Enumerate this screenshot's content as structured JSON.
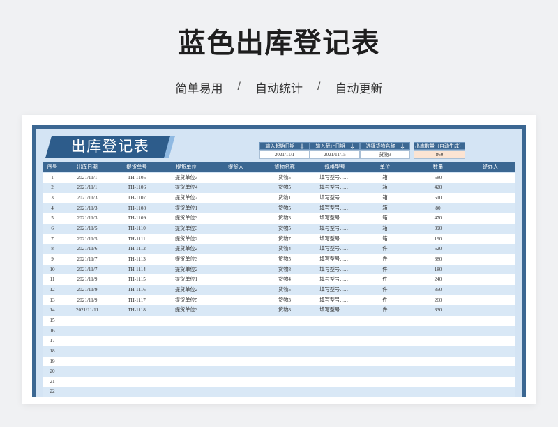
{
  "page": {
    "title": "蓝色出库登记表",
    "features": [
      "简单易用",
      "自动统计",
      "自动更新"
    ],
    "feature_separator": "/"
  },
  "sheet": {
    "banner_title": "出库登记表",
    "filters": [
      {
        "label": "输入起始日期",
        "icon": "down-arrow-icon",
        "value": "2021/11/1"
      },
      {
        "label": "输入截止日期",
        "icon": "down-arrow-icon",
        "value": "2021/11/15"
      },
      {
        "label": "选择货物名称",
        "icon": "down-arrow-icon",
        "value": "货物3"
      }
    ],
    "summary": {
      "label": "出库数量（自动生成）",
      "value": 860
    },
    "columns": [
      "序号",
      "出库日期",
      "提货单号",
      "提货单位",
      "提货人",
      "货物名称",
      "规格型号",
      "单位",
      "数量",
      "经办人"
    ],
    "rows": [
      [
        1,
        "2021/11/1",
        "TH-1105",
        "提货单位3",
        null,
        "货物5",
        "填写型号……",
        "箱",
        580,
        null
      ],
      [
        2,
        "2021/11/1",
        "TH-1106",
        "提货单位4",
        null,
        "货物5",
        "填写型号……",
        "箱",
        420,
        null
      ],
      [
        3,
        "2021/11/3",
        "TH-1107",
        "提货单位2",
        null,
        "货物1",
        "填写型号……",
        "箱",
        510,
        null
      ],
      [
        4,
        "2021/11/3",
        "TH-1108",
        "提货单位1",
        null,
        "货物5",
        "填写型号……",
        "箱",
        80,
        null
      ],
      [
        5,
        "2021/11/3",
        "TH-1109",
        "提货单位3",
        null,
        "货物3",
        "填写型号……",
        "箱",
        470,
        null
      ],
      [
        6,
        "2021/11/5",
        "TH-1110",
        "提货单位3",
        null,
        "货物5",
        "填写型号……",
        "箱",
        390,
        null
      ],
      [
        7,
        "2021/11/5",
        "TH-1111",
        "提货单位2",
        null,
        "货物7",
        "填写型号……",
        "箱",
        190,
        null
      ],
      [
        8,
        "2021/11/6",
        "TH-1112",
        "提货单位2",
        null,
        "货物4",
        "填写型号……",
        "件",
        520,
        null
      ],
      [
        9,
        "2021/11/7",
        "TH-1113",
        "提货单位3",
        null,
        "货物5",
        "填写型号……",
        "件",
        380,
        null
      ],
      [
        10,
        "2021/11/7",
        "TH-1114",
        "提货单位2",
        null,
        "货物8",
        "填写型号……",
        "件",
        180,
        null
      ],
      [
        11,
        "2021/11/9",
        "TH-1115",
        "提货单位1",
        null,
        "货物4",
        "填写型号……",
        "件",
        240,
        null
      ],
      [
        12,
        "2021/11/9",
        "TH-1116",
        "提货单位2",
        null,
        "货物5",
        "填写型号……",
        "件",
        350,
        null
      ],
      [
        13,
        "2021/11/9",
        "TH-1117",
        "提货单位5",
        null,
        "货物3",
        "填写型号……",
        "件",
        260,
        null
      ],
      [
        14,
        "2021/11/11",
        "TH-1118",
        "提货单位3",
        null,
        "货物8",
        "填写型号……",
        "件",
        330,
        null
      ],
      [
        15
      ],
      [
        16
      ],
      [
        17
      ],
      [
        18
      ],
      [
        19
      ],
      [
        20
      ],
      [
        21
      ],
      [
        22
      ]
    ]
  },
  "colors": {
    "primary": "#3b6792",
    "banner": "#2d5c8b",
    "banner_accent": "#8fb9e2",
    "sheet_bg": "#d4e4f4",
    "row_alt": "#d9e8f6",
    "summary_fill": "#fce4d3"
  }
}
